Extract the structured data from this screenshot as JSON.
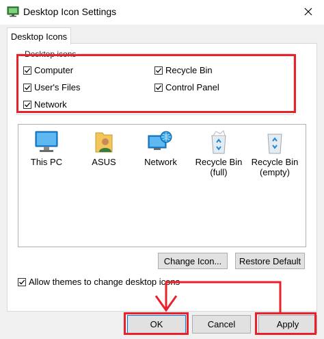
{
  "window": {
    "title": "Desktop Icon Settings"
  },
  "tabs": [
    {
      "label": "Desktop Icons"
    }
  ],
  "desktop_icons": {
    "legend": "Desktop icons",
    "checkboxes": [
      {
        "label": "Computer",
        "checked": true
      },
      {
        "label": "Recycle Bin",
        "checked": true
      },
      {
        "label": "User's Files",
        "checked": true
      },
      {
        "label": "Control Panel",
        "checked": true
      },
      {
        "label": "Network",
        "checked": true
      }
    ]
  },
  "icons": [
    {
      "label": "This PC",
      "icon": "computer-icon"
    },
    {
      "label": "ASUS",
      "icon": "user-folder-icon"
    },
    {
      "label": "Network",
      "icon": "network-icon"
    },
    {
      "label_line1": "Recycle Bin",
      "label_line2": "(full)",
      "icon": "recycle-bin-full-icon"
    },
    {
      "label_line1": "Recycle Bin",
      "label_line2": "(empty)",
      "icon": "recycle-bin-empty-icon"
    }
  ],
  "buttons": {
    "change_icon": "Change Icon...",
    "restore_default": "Restore Default",
    "ok": "OK",
    "cancel": "Cancel",
    "apply": "Apply"
  },
  "allow_themes": {
    "label": "Allow themes to change desktop icons",
    "checked": true
  },
  "colors": {
    "annotation_red": "#e8212a",
    "focus_blue": "#0078d7"
  }
}
